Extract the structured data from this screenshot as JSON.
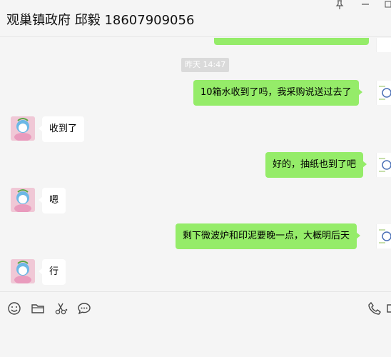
{
  "header": {
    "title": "观巢镇政府 邱毅 18607909056",
    "pin_icon": "pin-icon",
    "minimize_icon": "minimize-icon"
  },
  "chat": {
    "timestamp": "昨天 14:47",
    "messages": [
      {
        "side": "me",
        "text": "10箱水收到了吗，我采购说送过去了"
      },
      {
        "side": "them",
        "text": "收到了"
      },
      {
        "side": "me",
        "text": "好的，抽纸也到了吧"
      },
      {
        "side": "them",
        "text": "嗯"
      },
      {
        "side": "me",
        "text": "剩下微波炉和印泥要晚一点，大概明后天"
      },
      {
        "side": "them",
        "text": "行"
      }
    ]
  },
  "toolbar": {
    "icons": [
      "emoji-icon",
      "folder-icon",
      "scissors-icon",
      "chat-bubble-icon",
      "phone-icon"
    ]
  },
  "colors": {
    "my_bubble": "#95ec69",
    "their_bubble": "#ffffff",
    "background": "#f5f5f5",
    "timestamp_bg": "#dadada"
  }
}
